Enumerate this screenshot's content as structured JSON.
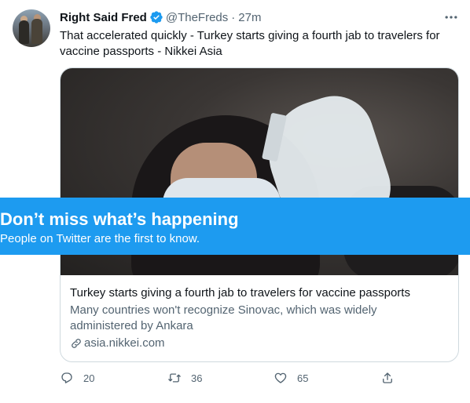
{
  "tweet": {
    "author_name": "Right Said Fred",
    "handle": "@TheFreds",
    "separator": "·",
    "time": "27m",
    "text_line1": "That accelerated quickly - Turkey starts giving a fourth jab to travelers for",
    "text_line2": "vaccine passports - Nikkei Asia",
    "verified_icon": "verified-badge-icon",
    "more_icon": "more-horizontal-icon"
  },
  "card": {
    "title": "Turkey starts giving a fourth jab to travelers for vaccine passports",
    "desc_line1": "Many countries won't recognize Sinovac, which was widely",
    "desc_line2": "administered by Ankara",
    "domain": "asia.nikkei.com",
    "link_icon": "link-icon"
  },
  "actions": {
    "reply_count": "20",
    "retweet_count": "36",
    "like_count": "65",
    "reply_icon": "reply-icon",
    "retweet_icon": "retweet-icon",
    "like_icon": "heart-icon",
    "share_icon": "share-icon"
  },
  "banner": {
    "title": "Don’t miss what’s happening",
    "subtitle": "People on Twitter are the first to know."
  },
  "colors": {
    "accent": "#1d9bf0",
    "text_primary": "#0f1419",
    "text_secondary": "#536471",
    "border": "#cfd9de"
  }
}
